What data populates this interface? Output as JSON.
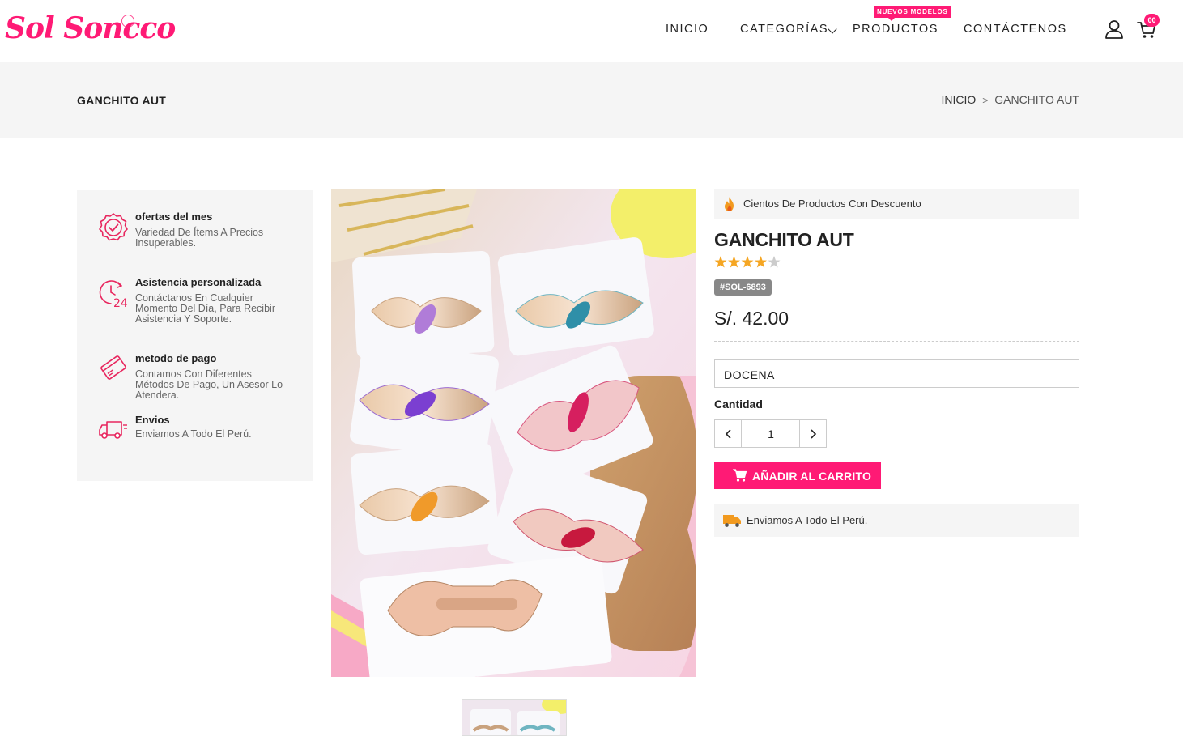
{
  "header": {
    "logo": "Sol Soncco",
    "nav": {
      "inicio": "INICIO",
      "categorias": "CATEGORÍAS",
      "productos": "PRODUCTOS",
      "productos_badge": "NUEVOS MODELOS",
      "contactenos": "CONTÁCTENOS"
    },
    "cart_count": "00",
    "icons": [
      "user-icon",
      "cart-icon",
      "chevron-down-icon"
    ]
  },
  "page": {
    "title": "GANCHITO AUT",
    "breadcrumb": {
      "home": "INICIO",
      "separator": ">",
      "current": "GANCHITO AUT"
    }
  },
  "features": [
    {
      "icon": "badge-check-icon",
      "title": "ofertas del mes",
      "text": "Variedad De Ítems A Precios Insuperables."
    },
    {
      "icon": "clock-24-icon",
      "title": "Asistencia personalizada",
      "text": "Contáctanos En Cualquier Momento Del Día, Para Recibir Asistencia Y Soporte."
    },
    {
      "icon": "credit-card-icon",
      "title": "metodo de pago",
      "text": "Contamos Con Diferentes Métodos De Pago, Un Asesor Lo Atendera."
    },
    {
      "icon": "delivery-truck-icon",
      "title": "Envios",
      "text": "Enviamos A Todo El Perú."
    }
  ],
  "product": {
    "promo_text": "Cientos De Productos Con Descuento",
    "name": "GANCHITO AUT",
    "rating": 4,
    "rating_max": 5,
    "sku": "#SOL-6893",
    "price": "S/. 42.00",
    "variant": "DOCENA",
    "quantity_label": "Cantidad",
    "quantity": "1",
    "add_to_cart": "AÑADIR AL CARRITO",
    "shipping_text": "Enviamos A Todo El Perú."
  },
  "colors": {
    "brand": "#ff1a75",
    "star": "#f5a623",
    "star_empty": "#cccccc",
    "panel_bg": "#f5f5f5"
  }
}
